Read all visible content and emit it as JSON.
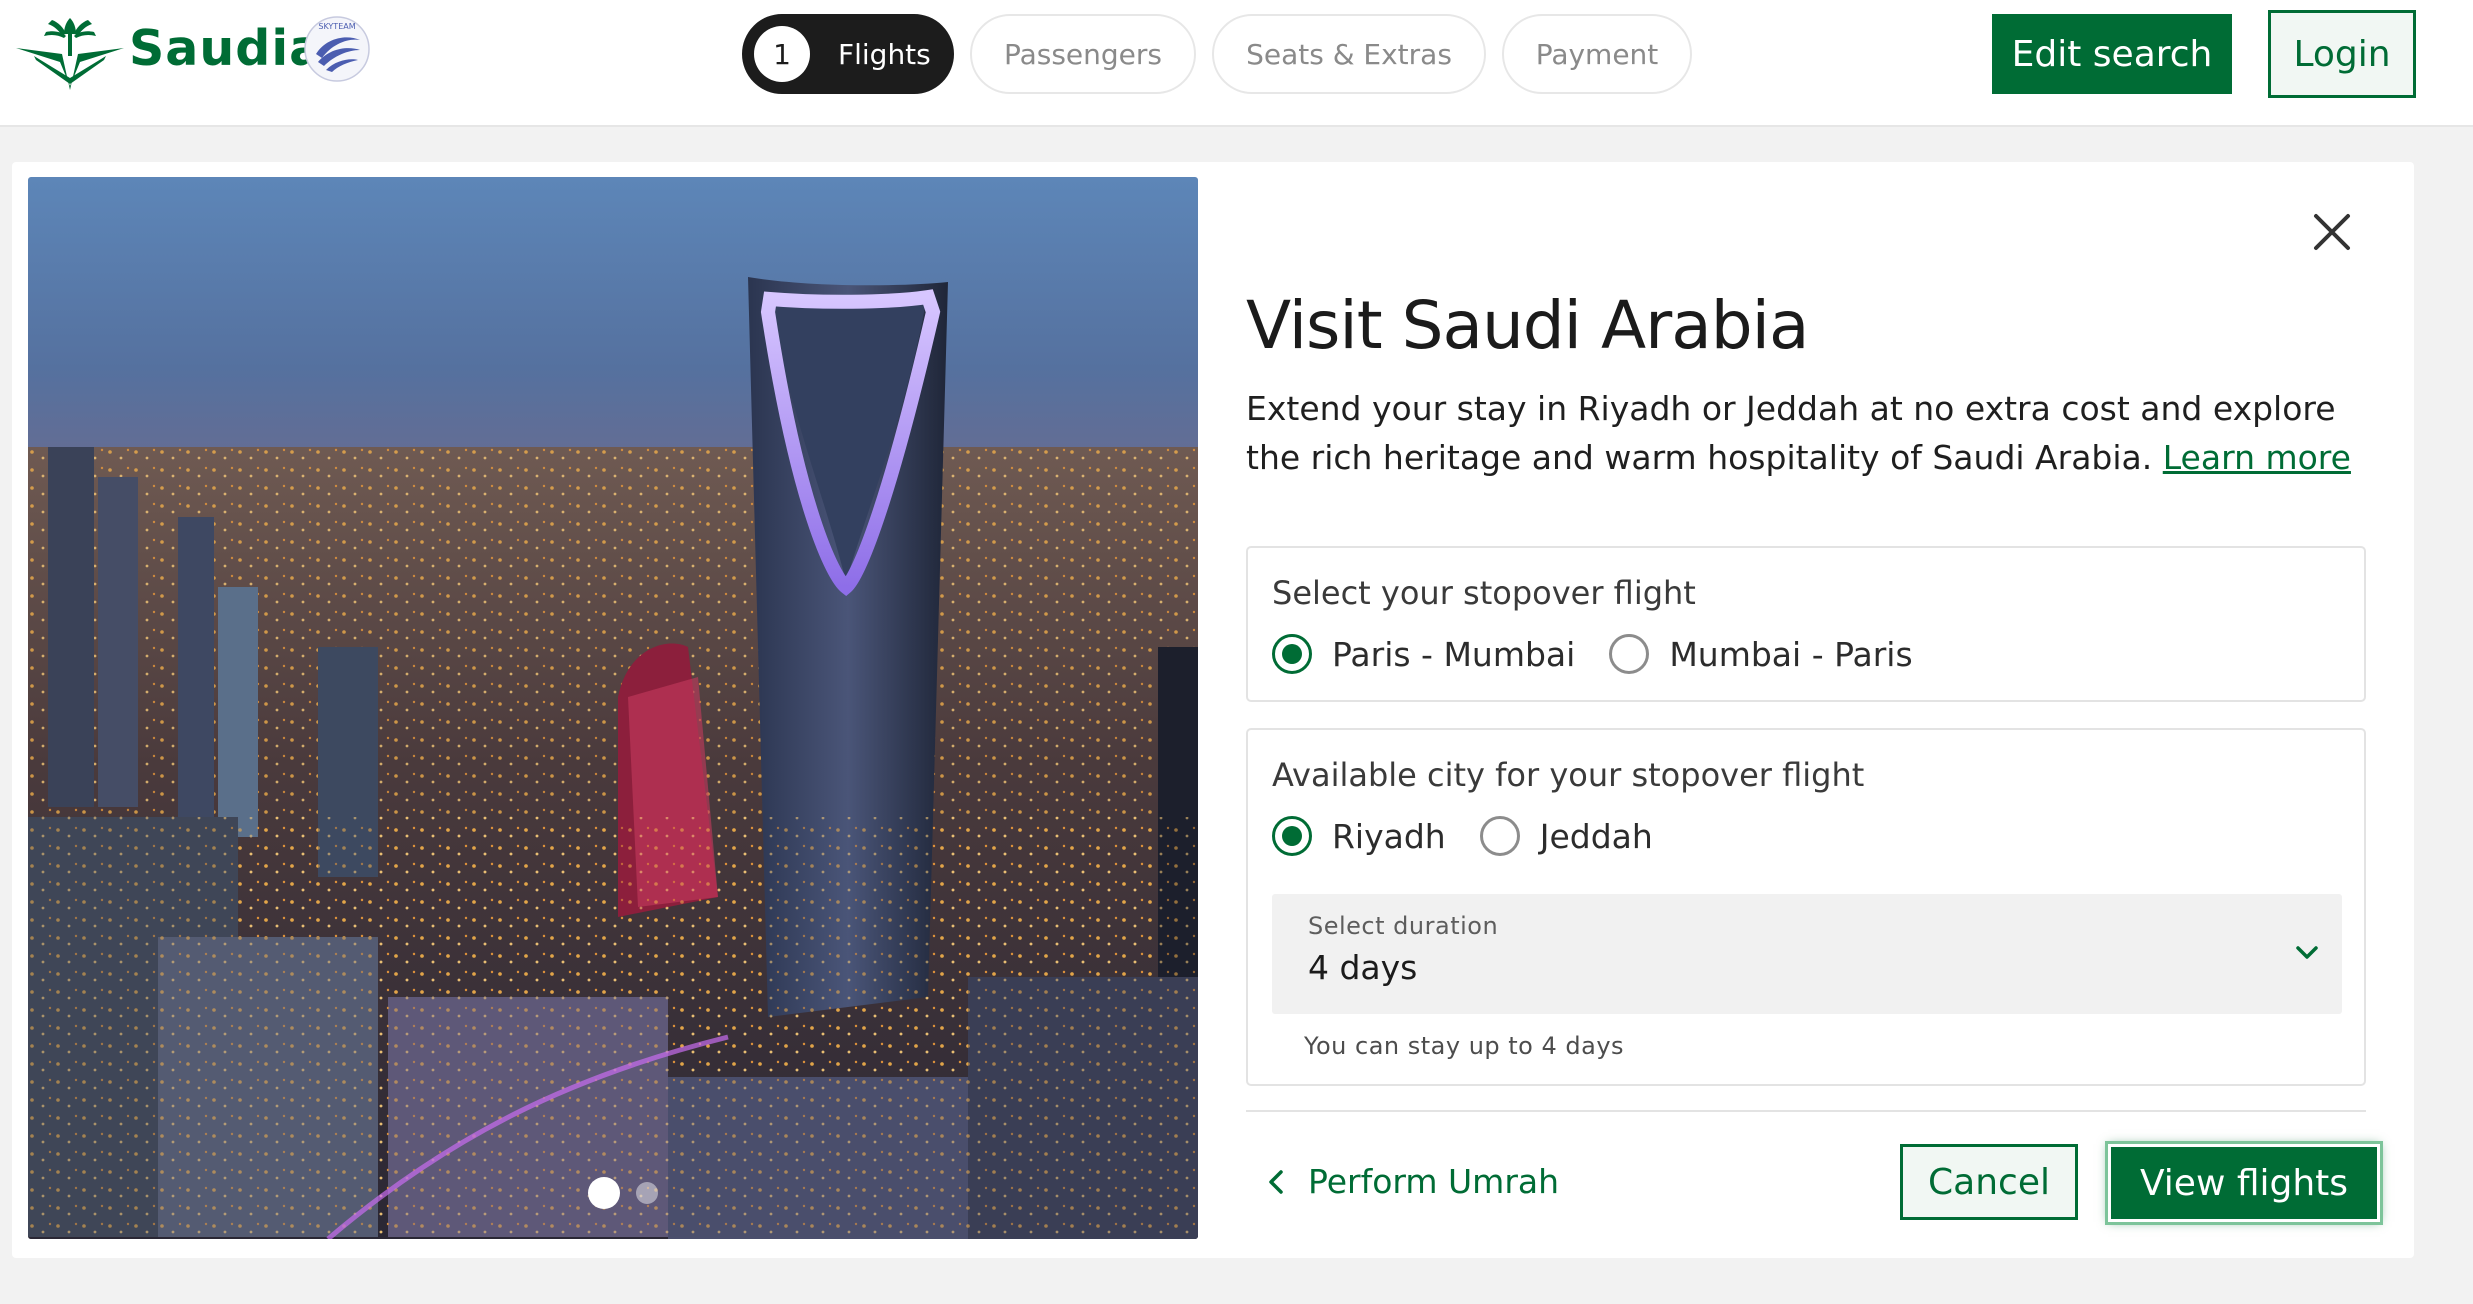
{
  "brand": {
    "name": "Saudia",
    "logo_icon": "saudia-palm-swords-logo",
    "alliance_icon": "skyteam-logo",
    "alliance_text": "SKYTEAM"
  },
  "steps": [
    {
      "number": "1",
      "label": "Flights",
      "active": true
    },
    {
      "label": "Passengers",
      "active": false
    },
    {
      "label": "Seats & Extras",
      "active": false
    },
    {
      "label": "Payment",
      "active": false
    }
  ],
  "header": {
    "edit_search_label": "Edit search",
    "login_label": "Login"
  },
  "colors": {
    "brand_green": "#006c35",
    "step_active_bg": "#1c1c1c"
  },
  "modal": {
    "title": "Visit Saudi Arabia",
    "description": "Extend your stay in Riyadh or Jeddah at no extra cost and explore the rich heritage and warm hospitality of Saudi Arabia.",
    "learn_more_label": "Learn more",
    "close_icon": "close-icon",
    "hero_image": "riyadh-kingdom-centre-night-skyline",
    "carousel": {
      "slides": 2,
      "active": 1
    },
    "stopover_flight": {
      "title": "Select your stopover flight",
      "options": [
        {
          "label": "Paris - Mumbai",
          "selected": true
        },
        {
          "label": "Mumbai - Paris",
          "selected": false
        }
      ]
    },
    "stopover_city": {
      "title": "Available city for your stopover flight",
      "options": [
        {
          "label": "Riyadh",
          "selected": true
        },
        {
          "label": "Jeddah",
          "selected": false
        }
      ],
      "duration": {
        "label": "Select duration",
        "value": "4 days",
        "hint": "You can stay up to 4 days"
      }
    },
    "back_link_label": "Perform Umrah",
    "cancel_label": "Cancel",
    "view_flights_label": "View flights"
  }
}
